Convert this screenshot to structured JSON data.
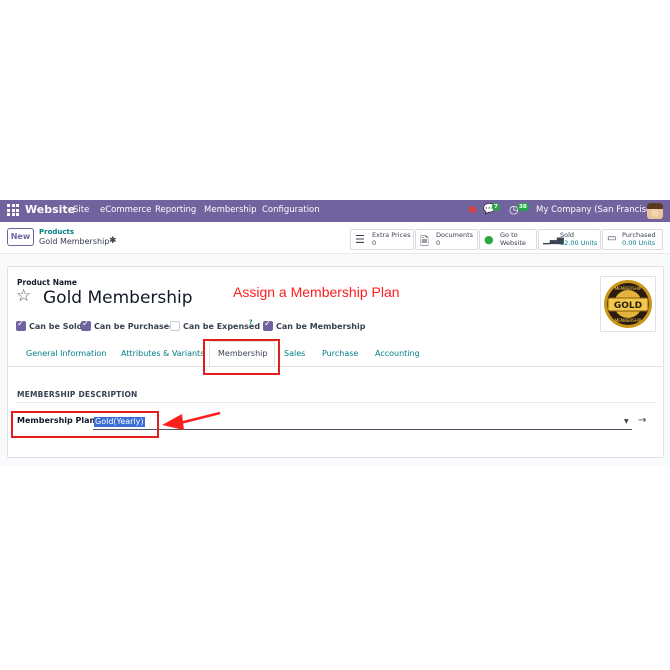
{
  "navbar": {
    "app_name": "Website",
    "menu": [
      "Site",
      "eCommerce",
      "Reporting",
      "Membership",
      "Configuration"
    ],
    "messages_count": "7",
    "activities_count": "38",
    "company": "My Company (San Francisco)",
    "bg_color": "#71639e"
  },
  "control_panel": {
    "new_label": "New",
    "breadcrumb_parent": "Products",
    "breadcrumb_current": "Gold Membership",
    "smart_buttons": [
      {
        "icon": "list-icon",
        "label": "Extra Prices",
        "value": "0"
      },
      {
        "icon": "document-icon",
        "label": "Documents",
        "value": "0"
      },
      {
        "icon": "globe-icon",
        "label": "Go to",
        "value": "Website"
      },
      {
        "icon": "bar-chart-icon",
        "label": "Sold",
        "value": "12.00 Units"
      },
      {
        "icon": "cart-icon",
        "label": "Purchased",
        "value": "0.00 Units"
      }
    ]
  },
  "form": {
    "product_name_label": "Product Name",
    "product_name": "Gold Membership",
    "annotation": "Assign a Membership Plan",
    "badge": {
      "top_text": "MEMBERSHIP",
      "center_text": "GOLD",
      "bottom_text": "MEMBERSHIP"
    },
    "checkboxes": [
      {
        "label": "Can be Sold",
        "checked": true
      },
      {
        "label": "Can be Purchased",
        "checked": true
      },
      {
        "label": "Can be Expensed",
        "checked": false
      },
      {
        "label": "Can be Membership",
        "checked": true
      }
    ],
    "help_mark": "?",
    "tabs": [
      "General Information",
      "Attributes & Variants",
      "Membership",
      "Sales",
      "Purchase",
      "Accounting"
    ],
    "active_tab": "Membership",
    "section_title": "MEMBERSHIP DESCRIPTION",
    "membership_plan_label": "Membership Plan",
    "membership_plan_value": "Gold(Yearly)"
  },
  "colors": {
    "accent": "#71639e",
    "link": "#017e84",
    "annotation_red": "#e11d1d"
  }
}
